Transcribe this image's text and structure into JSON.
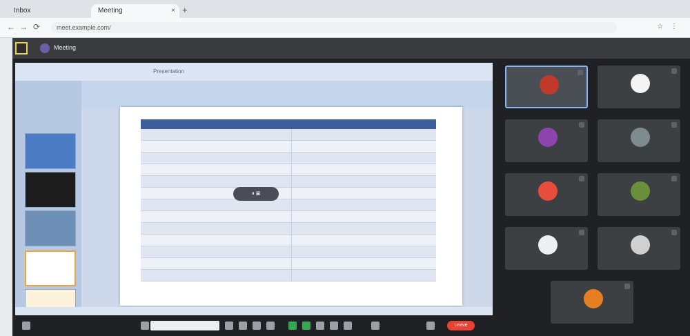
{
  "browser": {
    "tabs": [
      {
        "label": "Inbox"
      },
      {
        "label": "Meeting"
      }
    ],
    "new_tab": "+",
    "close": "×",
    "omnibox_value": "meet.example.com/",
    "nav_back": "←",
    "nav_forward": "→",
    "nav_reload": "⟳",
    "toolbar_icons": "☆ ⋮"
  },
  "meeting": {
    "title": "Meeting",
    "share_caption": "Presentation",
    "floating_control": "⏸ ▣",
    "slide_table": {
      "headers": [
        "",
        ""
      ],
      "rows": [
        [
          "",
          ""
        ],
        [
          "",
          ""
        ],
        [
          "",
          ""
        ],
        [
          "",
          ""
        ],
        [
          "",
          ""
        ],
        [
          "",
          ""
        ],
        [
          "",
          ""
        ],
        [
          "",
          ""
        ],
        [
          "",
          ""
        ],
        [
          "",
          ""
        ],
        [
          "",
          ""
        ],
        [
          "",
          ""
        ],
        [
          "",
          ""
        ]
      ]
    },
    "participants": [
      {
        "name": "",
        "color": "#c0392b",
        "active": true
      },
      {
        "name": "",
        "color": "#f4f4f4",
        "active": false
      },
      {
        "name": "",
        "color": "#8e44ad",
        "active": false
      },
      {
        "name": "",
        "color": "#7f8c8d",
        "active": false
      },
      {
        "name": "",
        "color": "#e74c3c",
        "active": false
      },
      {
        "name": "",
        "color": "#6a8f3a",
        "active": false
      },
      {
        "name": "",
        "color": "#ecf0f1",
        "active": false
      },
      {
        "name": "",
        "color": "#d0d0d0",
        "active": false
      },
      {
        "name": "",
        "color": "#e67e22",
        "active": false
      }
    ],
    "leave_label": "Leave"
  },
  "colors": {
    "meeting_bg": "#202124",
    "slide_header": "#3c5e99",
    "accent": "#8ab4f8",
    "leave": "#ea4335"
  }
}
